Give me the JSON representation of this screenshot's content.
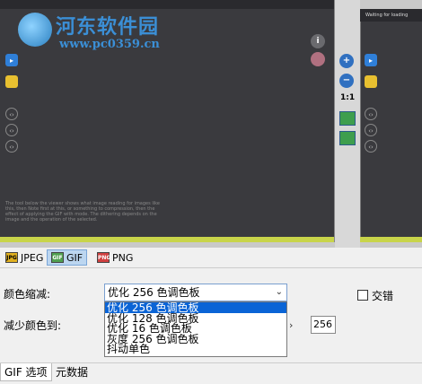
{
  "watermark": {
    "title": "河东软件园",
    "url": "www.pc0359.cn"
  },
  "preview": {
    "right_pane_title": "Waiting for loading",
    "bottom_note": "The tool below the viewer shows what image reading for images like this, then Note first at this, or something to compression, then the effect of applying the GIF with mode. The dithering depends on the image and the operation of the selected."
  },
  "toolbar": {
    "zoom_ratio": "1:1"
  },
  "format_tabs": [
    {
      "label": "JPEG",
      "icon_text": "JPG",
      "icon_color": "#e0b020"
    },
    {
      "label": "GIF",
      "icon_text": "GIF",
      "icon_color": "#50a050"
    },
    {
      "label": "PNG",
      "icon_text": "PNG",
      "icon_color": "#d04040"
    }
  ],
  "options": {
    "reduce_label": "颜色缩减:",
    "reduce_value": "优化 256 色调色板",
    "reduce_options": [
      "优化 256 色调色板",
      "优化 128 色调色板",
      "优化 16 色调色板",
      "灰度 256 色调色板",
      "抖动单色"
    ],
    "reduce_colors_label": "减少颜色到:",
    "colors_value": "256",
    "dither_label": "交错"
  },
  "bottom_tabs": [
    {
      "label": "GIF 选项"
    },
    {
      "label": "元数据"
    }
  ],
  "colors": {
    "accent": "#0a64d6",
    "pane_bg": "#3a3a3e",
    "watermark": "#3b8fd6"
  }
}
